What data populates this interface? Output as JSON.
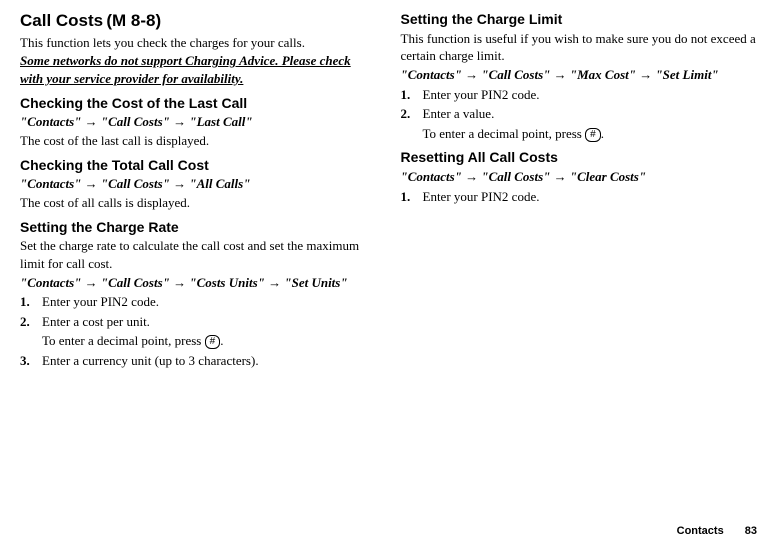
{
  "left": {
    "title": "Call Costs",
    "menu_ref": "(M 8-8)",
    "intro": "This function lets you check the charges for your calls.",
    "note": "Some networks do not support Charging Advice. Please check with your service provider for availability.",
    "sec1": {
      "heading": "Checking the Cost of the Last Call",
      "path_parts": [
        "\"Contacts\"",
        "\"Call Costs\"",
        "\"Last Call\""
      ],
      "desc": "The cost of the last call is displayed."
    },
    "sec2": {
      "heading": "Checking the Total Call Cost",
      "path_parts": [
        "\"Contacts\"",
        "\"Call Costs\"",
        "\"All Calls\""
      ],
      "desc": "The cost of all calls is displayed."
    },
    "sec3": {
      "heading": "Setting the Charge Rate",
      "desc": "Set the charge rate to calculate the call cost and set the maximum limit for call cost.",
      "path_parts": [
        "\"Contacts\"",
        "\"Call Costs\"",
        "\"Costs Units\"",
        "\"Set Units\""
      ],
      "steps": [
        {
          "num": "1.",
          "text": "Enter your PIN2 code."
        },
        {
          "num": "2.",
          "text": "Enter a cost per unit.",
          "extra_pre": "To enter a decimal point, press ",
          "key": "#",
          "extra_post": "."
        },
        {
          "num": "3.",
          "text": "Enter a currency unit (up to 3 characters)."
        }
      ]
    }
  },
  "right": {
    "sec1": {
      "heading": "Setting the Charge Limit",
      "desc": "This function is useful if you wish to make sure you do not exceed a certain charge limit.",
      "path_parts": [
        "\"Contacts\"",
        "\"Call Costs\"",
        "\"Max Cost\"",
        "\"Set Limit\""
      ],
      "steps": [
        {
          "num": "1.",
          "text": "Enter your PIN2 code."
        },
        {
          "num": "2.",
          "text": "Enter a value.",
          "extra_pre": "To enter a decimal point, press ",
          "key": "#",
          "extra_post": "."
        }
      ]
    },
    "sec2": {
      "heading": "Resetting All Call Costs",
      "path_parts": [
        "\"Contacts\"",
        "\"Call Costs\"",
        "\"Clear Costs\""
      ],
      "steps": [
        {
          "num": "1.",
          "text": "Enter your PIN2 code."
        }
      ]
    }
  },
  "arrow": "→",
  "footer": {
    "section": "Contacts",
    "page": "83"
  }
}
